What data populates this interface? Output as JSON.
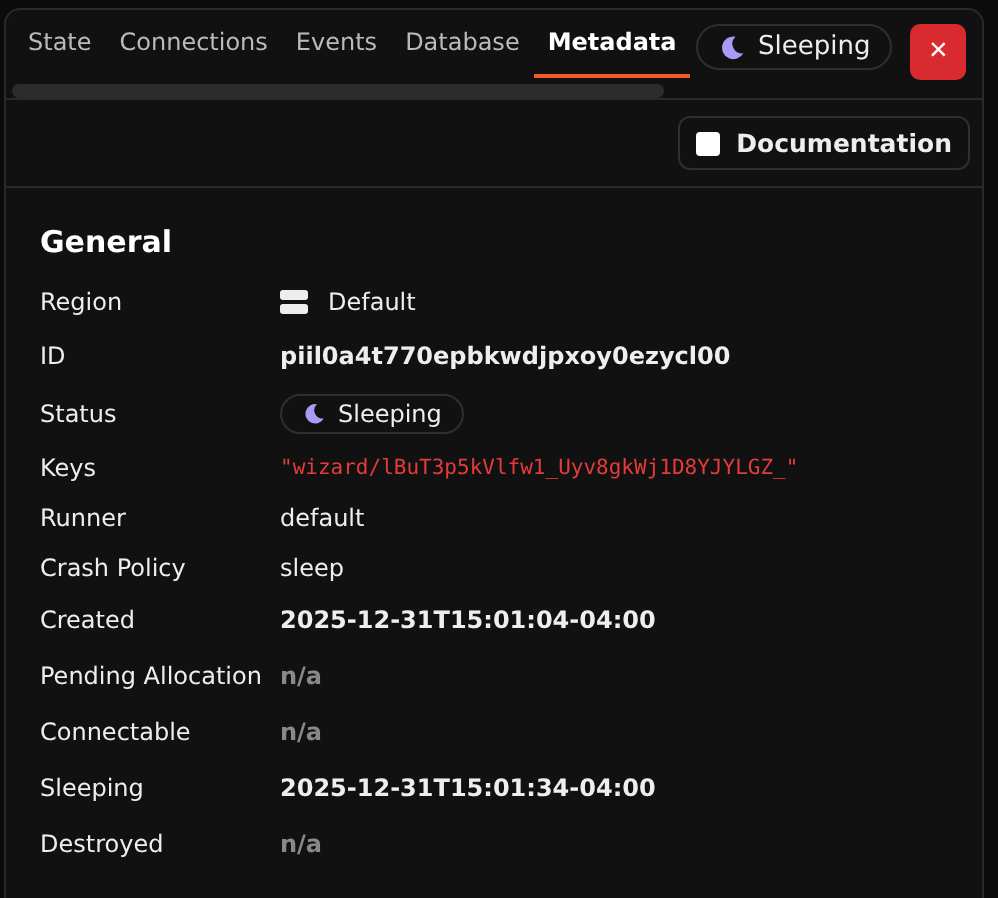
{
  "tabs": [
    {
      "label": "State",
      "selected": false
    },
    {
      "label": "Connections",
      "selected": false
    },
    {
      "label": "Events",
      "selected": false
    },
    {
      "label": "Database",
      "selected": false
    },
    {
      "label": "Metadata",
      "selected": true
    }
  ],
  "status_badge": {
    "label": "Sleeping"
  },
  "close_button": {
    "label": "×"
  },
  "documentation": {
    "label": "Documentation",
    "checked": false
  },
  "section": {
    "title": "General"
  },
  "fields": [
    {
      "label": "Region",
      "kind": "region",
      "value": "Default"
    },
    {
      "label": "ID",
      "kind": "bold",
      "value": "piil0a4t770epbkwdjpxoy0ezycl00"
    },
    {
      "label": "Status",
      "kind": "status",
      "value": "Sleeping"
    },
    {
      "label": "Keys",
      "kind": "code",
      "value": "\"wizard/lBuT3p5kVlfw1_Uyv8gkWj1D8YJYLGZ_\""
    },
    {
      "label": "Runner",
      "kind": "plain",
      "value": "default"
    },
    {
      "label": "Crash Policy",
      "kind": "plain",
      "value": "sleep"
    },
    {
      "label": "Created",
      "kind": "bold",
      "value": "2025-12-31T15:01:04-04:00"
    },
    {
      "label": "Pending Allocation",
      "kind": "na",
      "value": "n/a"
    },
    {
      "label": "Connectable",
      "kind": "na",
      "value": "n/a"
    },
    {
      "label": "Sleeping",
      "kind": "bold",
      "value": "2025-12-31T15:01:34-04:00"
    },
    {
      "label": "Destroyed",
      "kind": "na",
      "value": "n/a"
    }
  ]
}
